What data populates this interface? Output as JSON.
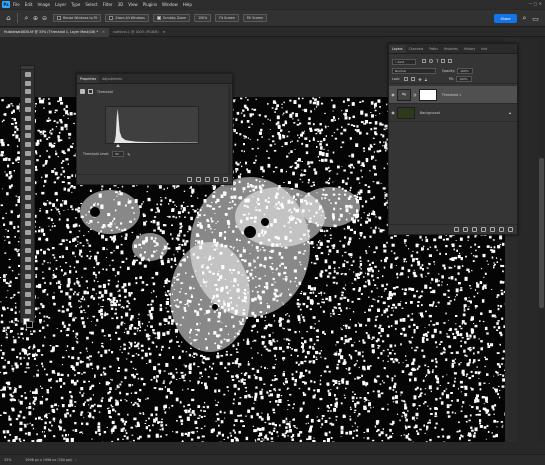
{
  "app": {
    "logo": "Ps"
  },
  "menu": [
    "File",
    "Edit",
    "Image",
    "Layer",
    "Type",
    "Select",
    "Filter",
    "3D",
    "View",
    "Plugins",
    "Window",
    "Help"
  ],
  "options": {
    "resize_windows": "Resize Windows to Fit",
    "zoom_all": "Zoom All Windows",
    "scrubby_zoom": "Scrubby Zoom",
    "zoom_value": "100%",
    "fit_screen": "Fit Screen",
    "fill_screen": "Fill Screen",
    "share": "Share"
  },
  "tabs": [
    {
      "label": "Hubblesat0830.tif @ 33% (Threshold 1, Layer Mask/16) *",
      "active": true
    },
    {
      "label": "nathbnd-1 @ 100% (RGB/8)",
      "active": false
    }
  ],
  "properties": {
    "tabs": [
      "Properties",
      "Adjustments"
    ],
    "title": "Threshold",
    "threshold_label": "Threshold Level:",
    "threshold_value": "85"
  },
  "layers_panel": {
    "tabs": [
      "Layers",
      "Channels",
      "Paths",
      "Histories",
      "History",
      "Info"
    ],
    "kind": "Kind",
    "blend_mode": "Normal",
    "opacity_label": "Opacity:",
    "opacity_value": "100%",
    "lock_label": "Lock:",
    "fill_label": "Fill:",
    "fill_value": "100%",
    "layers": [
      {
        "name": "Threshold 1",
        "selected": true
      },
      {
        "name": "Background",
        "selected": false
      }
    ]
  },
  "status": {
    "zoom": "33%",
    "doc_info": "2996 px x 1996 px (300 ppi)"
  },
  "colors": {
    "accent": "#1473e6",
    "ps_blue": "#31a8ff",
    "bg_thumb": "#2e3a1e"
  },
  "icons": [
    "home-icon",
    "zoom-tool-icon",
    "zoom-in-icon",
    "zoom-out-icon",
    "eye-icon",
    "lock-icon",
    "chain-icon"
  ]
}
